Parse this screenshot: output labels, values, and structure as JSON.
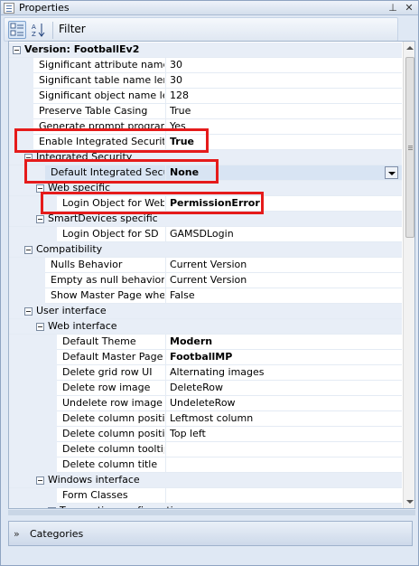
{
  "window": {
    "title": "Properties"
  },
  "toolbar": {
    "filter_label": "Filter"
  },
  "rows": [
    {
      "type": "cat",
      "level": 0,
      "label": "Version: FootballEv2",
      "bold": true
    },
    {
      "type": "prop",
      "level": 1,
      "label": "Significant attribute name lengt",
      "value": "30"
    },
    {
      "type": "prop",
      "level": 1,
      "label": "Significant table name length",
      "value": "30"
    },
    {
      "type": "prop",
      "level": 1,
      "label": "Significant object name length",
      "value": "128"
    },
    {
      "type": "prop",
      "level": 1,
      "label": "Preserve Table Casing",
      "value": "True"
    },
    {
      "type": "prop",
      "level": 1,
      "label": "Generate prompt programs",
      "value": "Yes"
    },
    {
      "type": "prop",
      "level": 1,
      "label": "Enable Integrated Security",
      "value": "True",
      "bold": true
    },
    {
      "type": "cat",
      "level": 1,
      "label": "Integrated Security"
    },
    {
      "type": "prop",
      "level": 2,
      "label": "Default Integrated Security l",
      "value": "None",
      "bold": true,
      "dropdown": true
    },
    {
      "type": "cat",
      "level": 2,
      "label": "Web specific"
    },
    {
      "type": "prop",
      "level": 3,
      "label": "Login Object for Web",
      "value": "PermissionError",
      "bold": true
    },
    {
      "type": "cat",
      "level": 2,
      "label": "SmartDevices specific"
    },
    {
      "type": "prop",
      "level": 3,
      "label": "Login Object for SD",
      "value": "GAMSDLogin"
    },
    {
      "type": "cat",
      "level": 1,
      "label": "Compatibility"
    },
    {
      "type": "prop",
      "level": 2,
      "label": "Nulls Behavior",
      "value": "Current Version"
    },
    {
      "type": "prop",
      "level": 2,
      "label": "Empty as null behavior",
      "value": "Current Version"
    },
    {
      "type": "prop",
      "level": 2,
      "label": "Show Master Page when Pop",
      "value": "False"
    },
    {
      "type": "cat",
      "level": 1,
      "label": "User interface"
    },
    {
      "type": "cat",
      "level": 2,
      "label": "Web interface"
    },
    {
      "type": "prop",
      "level": 3,
      "label": "Default Theme",
      "value": "Modern",
      "bold": true
    },
    {
      "type": "prop",
      "level": 3,
      "label": "Default Master Page",
      "value": "FootballMP",
      "bold": true
    },
    {
      "type": "prop",
      "level": 3,
      "label": "Delete grid row UI",
      "value": "Alternating images"
    },
    {
      "type": "prop",
      "level": 3,
      "label": "Delete row image",
      "value": "DeleteRow"
    },
    {
      "type": "prop",
      "level": 3,
      "label": "Undelete row image",
      "value": "UndeleteRow"
    },
    {
      "type": "prop",
      "level": 3,
      "label": "Delete column position in g",
      "value": "Leftmost column"
    },
    {
      "type": "prop",
      "level": 3,
      "label": "Delete column position in f",
      "value": "Top left"
    },
    {
      "type": "prop",
      "level": 3,
      "label": "Delete column tooltip text",
      "value": ""
    },
    {
      "type": "prop",
      "level": 3,
      "label": "Delete column title",
      "value": ""
    },
    {
      "type": "cat",
      "level": 2,
      "label": "Windows interface"
    },
    {
      "type": "prop",
      "level": 3,
      "label": "Form Classes",
      "value": ""
    },
    {
      "type": "cat",
      "level": 3,
      "label": "Transaction configuration"
    }
  ],
  "categories_panel": {
    "label": "Categories"
  },
  "colors": {
    "highlight": "#e51b1b",
    "category_bg": "#e8eef7"
  }
}
